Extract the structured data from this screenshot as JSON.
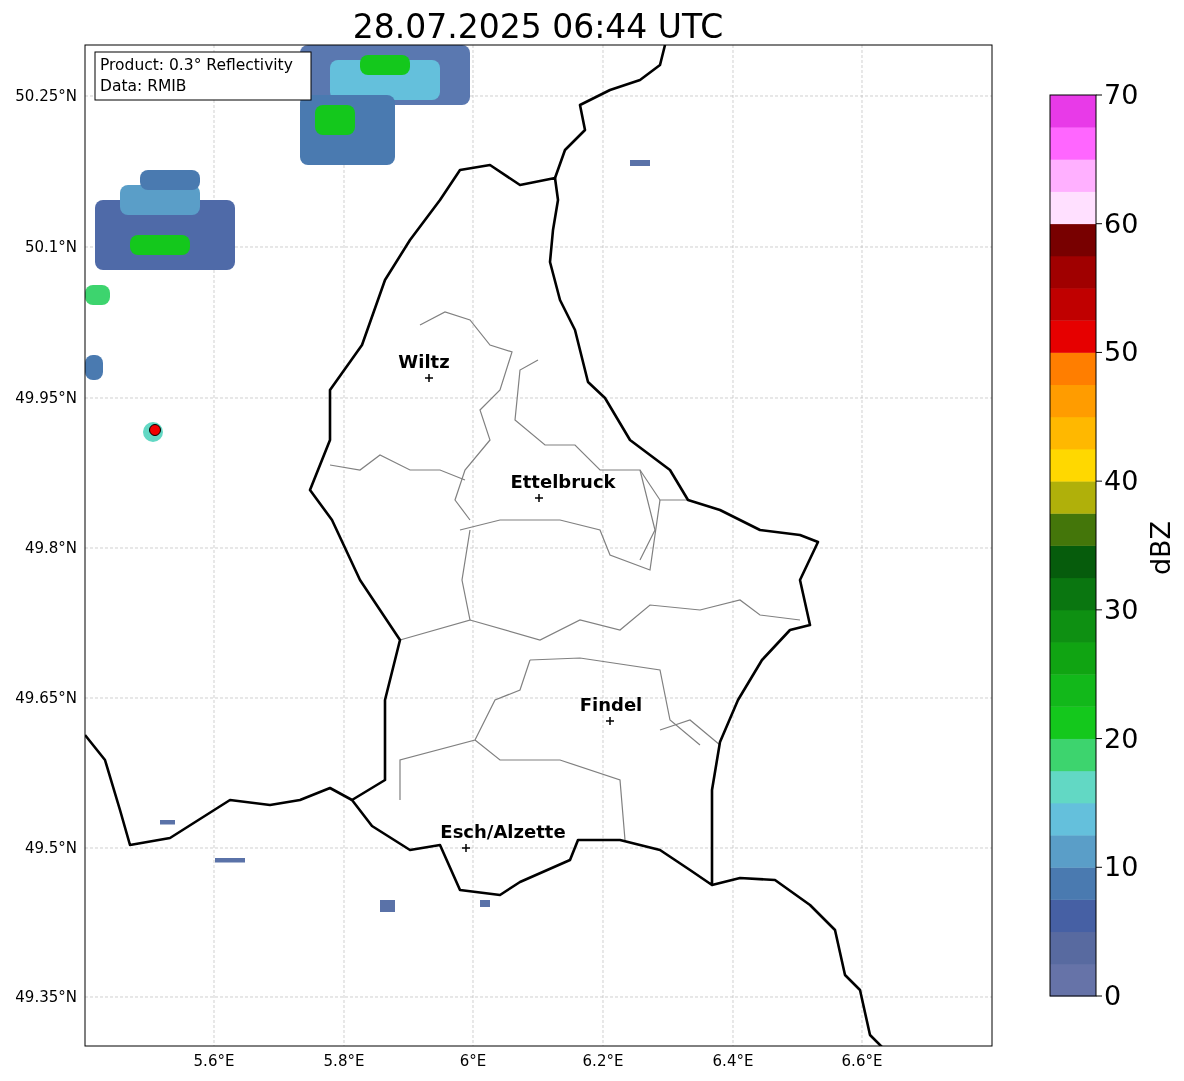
{
  "title": "28.07.2025 06:44 UTC",
  "info_box": [
    "Product: 0.3° Reflectivity",
    "Data: RMIB"
  ],
  "map": {
    "y_ticks": [
      "50.25°N",
      "50.1°N",
      "49.95°N",
      "49.8°N",
      "49.65°N",
      "49.5°N",
      "49.35°N"
    ],
    "x_ticks": [
      "5.6°E",
      "5.8°E",
      "6°E",
      "6.2°E",
      "6.4°E",
      "6.6°E"
    ],
    "cities": [
      {
        "name": "Wiltz"
      },
      {
        "name": "Ettelbruck"
      },
      {
        "name": "Findel"
      },
      {
        "name": "Esch/Alzette"
      }
    ]
  },
  "colorbar": {
    "label": "dBZ",
    "ticks": [
      "70",
      "60",
      "50",
      "40",
      "30",
      "20",
      "10",
      "0"
    ],
    "bands": [
      {
        "color": "#6673a8"
      },
      {
        "color": "#586aa0"
      },
      {
        "color": "#4660a4"
      },
      {
        "color": "#4a7ab0"
      },
      {
        "color": "#5a9ec8"
      },
      {
        "color": "#64c0dc"
      },
      {
        "color": "#62d8c4"
      },
      {
        "color": "#3dd46e"
      },
      {
        "color": "#14c81c"
      },
      {
        "color": "#12b81a"
      },
      {
        "color": "#10a412"
      },
      {
        "color": "#0e9012"
      },
      {
        "color": "#0a7610"
      },
      {
        "color": "#065c0c"
      },
      {
        "color": "#44760a"
      },
      {
        "color": "#b0b00a"
      },
      {
        "color": "#ffd800"
      },
      {
        "color": "#ffb800"
      },
      {
        "color": "#ff9c00"
      },
      {
        "color": "#ff7e00"
      },
      {
        "color": "#e60000"
      },
      {
        "color": "#c00000"
      },
      {
        "color": "#a00000"
      },
      {
        "color": "#780000"
      },
      {
        "color": "#ffe0ff"
      },
      {
        "color": "#ffb0ff"
      },
      {
        "color": "#ff66ff"
      },
      {
        "color": "#e83ae8"
      }
    ]
  }
}
